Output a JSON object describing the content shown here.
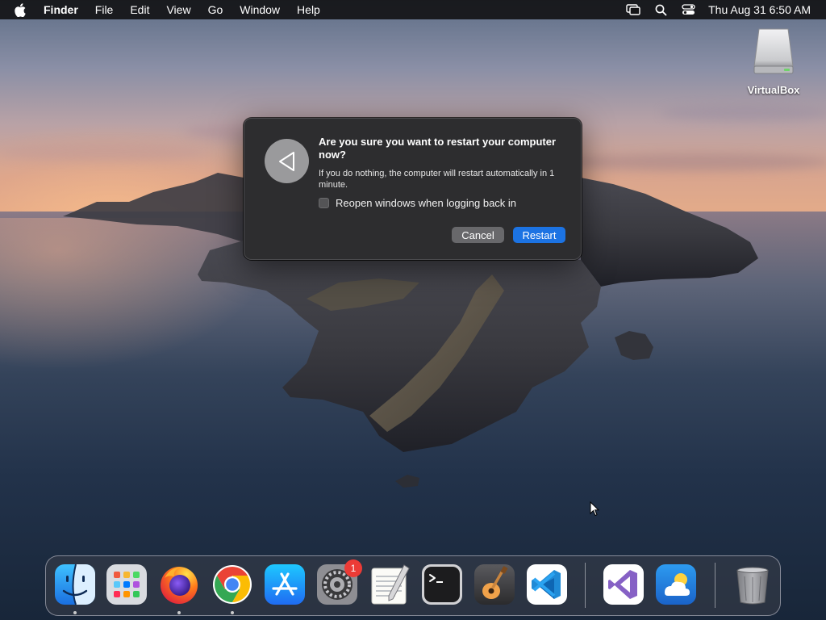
{
  "menubar": {
    "app_name": "Finder",
    "menus": [
      "File",
      "Edit",
      "View",
      "Go",
      "Window",
      "Help"
    ],
    "status_icons": [
      "screen-mirroring-icon",
      "spotlight-search-icon",
      "control-center-icon"
    ],
    "clock": "Thu Aug 31  6:50 AM"
  },
  "desktop": {
    "icons": [
      {
        "label": "VirtualBox",
        "icon": "external-drive-icon"
      }
    ]
  },
  "dialog": {
    "icon": "restart-icon",
    "title": "Are you sure you want to restart your computer now?",
    "message": "If you do nothing, the computer will restart automatically in 1 minute.",
    "checkbox_label": "Reopen windows when logging back in",
    "checkbox_checked": false,
    "cancel_label": "Cancel",
    "confirm_label": "Restart"
  },
  "dock": {
    "apps": [
      {
        "name": "finder-icon",
        "running": true
      },
      {
        "name": "launchpad-icon",
        "running": false
      },
      {
        "name": "firefox-icon",
        "running": true
      },
      {
        "name": "chrome-icon",
        "running": true
      },
      {
        "name": "app-store-icon",
        "running": false
      },
      {
        "name": "system-settings-icon",
        "running": false,
        "badge": "1"
      },
      {
        "name": "textedit-icon",
        "running": false
      },
      {
        "name": "terminal-icon",
        "running": false
      },
      {
        "name": "garageband-icon",
        "running": false
      },
      {
        "name": "vscode-icon",
        "running": false
      },
      {
        "name": "visual-studio-icon",
        "running": false
      },
      {
        "name": "weather-icon",
        "running": false
      },
      {
        "name": "trash-icon",
        "running": false
      }
    ]
  },
  "colors": {
    "dialog_bg": "#2d2d2f",
    "primary_button": "#1c73e3",
    "secondary_button": "#68686b",
    "badge": "#ec3b36"
  }
}
